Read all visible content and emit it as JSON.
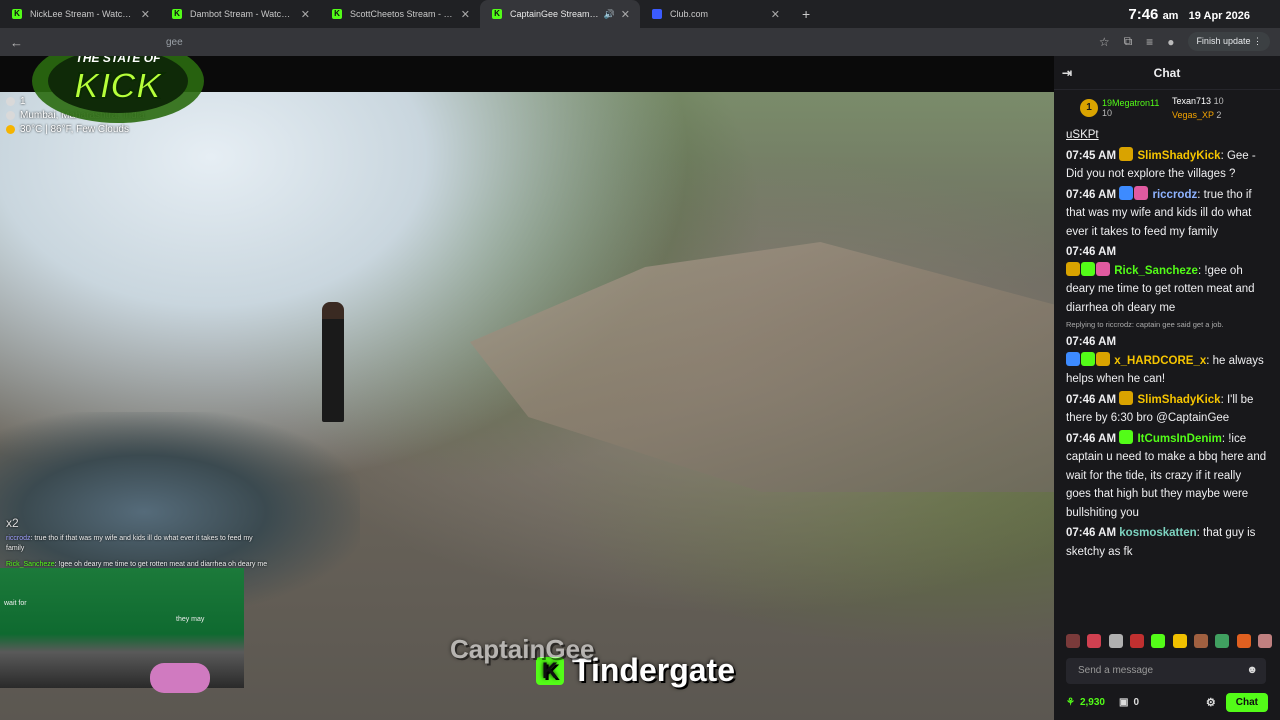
{
  "browser": {
    "tabs": [
      {
        "title": "NickLee Stream - Watch Live on Kick",
        "favicon": "K",
        "active": false
      },
      {
        "title": "Dambot Stream - Watch Live on Kick",
        "favicon": "K",
        "active": false
      },
      {
        "title": "ScottCheetos Stream - Watch Live on Kick",
        "favicon": "K",
        "active": false
      },
      {
        "title": "CaptainGee Stream - Watch Live on Kick",
        "favicon": "K",
        "active": true
      },
      {
        "title": "Club.com",
        "favicon": "",
        "active": false
      }
    ],
    "close_glyph": "✕",
    "new_tab_glyph": "+",
    "clock": {
      "time": "7:46",
      "ampm": "am",
      "date": "19 Apr 2026"
    },
    "url_fragment": "gee",
    "finish_update_label": "Finish update"
  },
  "stream": {
    "logo_text_top": "THE STATE OF",
    "logo_text_main": "KICK",
    "info": {
      "line1": "1",
      "location": "Mumbai, Maharashtra, India",
      "weather": "30°C | 86°F, Few Clouds"
    },
    "overlay_chat": {
      "multiplier": "x2",
      "line1_user": "riccrodz",
      "line1_text": ": true tho if that was my wife and kids ill do what ever it takes to feed my family",
      "line2_user": "Rick_Sancheze",
      "line2_text": ": !gee oh deary me time to get rotten meat and diarrhea oh deary me"
    },
    "webcam_text1": "wait for",
    "webcam_text2": "they may",
    "caption_back": "CaptainGee",
    "caption_front": "Tindergate",
    "caption_badge": "K"
  },
  "chat": {
    "title": "Chat",
    "leaders": [
      {
        "name": "19Megatron11",
        "count": "10",
        "rank": "1"
      },
      {
        "name": "Texan713",
        "count": "10"
      },
      {
        "name": "Vegas_XP",
        "count": "2"
      }
    ],
    "partial_top": "uSKPt",
    "messages": [
      {
        "time": "07:45 AM",
        "user": "SlimShadyKick",
        "text": ": Gee - Did you not explore the villages ?"
      },
      {
        "time": "07:46 AM",
        "user": "riccrodz",
        "text": ": true tho if that was my wife and kids ill do what ever it takes to feed my family"
      },
      {
        "time": "07:46 AM",
        "user": "Rick_Sancheze",
        "text": ": !gee oh deary me time to get rotten meat and diarrhea oh deary me"
      },
      {
        "reply": "Replying to riccrodz: captain gee said get a job."
      },
      {
        "time": "07:46 AM",
        "user": "x_HARDCORE_x",
        "text": ": he always helps when he can!"
      },
      {
        "time": "07:46 AM",
        "user": "SlimShadyKick",
        "text": ": I'll be there by 6:30 bro @CaptainGee"
      },
      {
        "time": "07:46 AM",
        "user": "ItCumsInDenim",
        "text": ": !ice captain u need to make a bbq here and wait for the tide, its crazy if it really goes that high but they maybe were bullshiting you"
      },
      {
        "time": "07:46 AM",
        "user": "kosmoskatten",
        "text": ": that guy is sketchy as fk"
      }
    ],
    "input_placeholder": "Send a message",
    "points": "2,930",
    "other_count": "0",
    "chat_button": "Chat"
  }
}
